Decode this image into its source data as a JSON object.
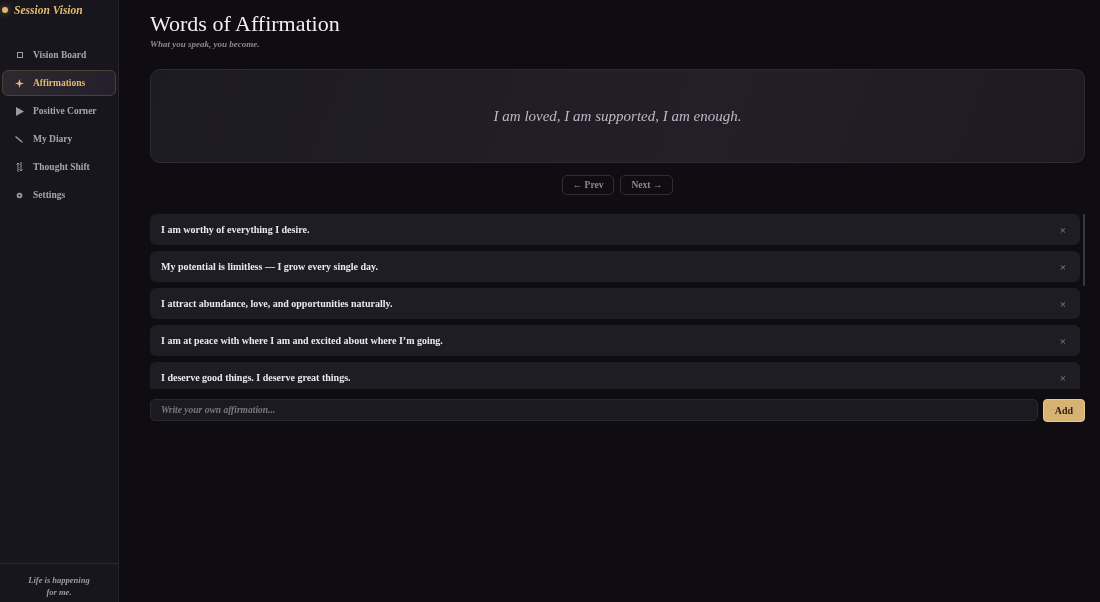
{
  "sidebar": {
    "brand": "Session Vision",
    "items": [
      {
        "label": "Vision Board",
        "selected": false
      },
      {
        "label": "Affirmations",
        "selected": true
      },
      {
        "label": "Positive Corner",
        "selected": false
      },
      {
        "label": "My Diary",
        "selected": false
      },
      {
        "label": "Thought Shift",
        "selected": false
      },
      {
        "label": "Settings",
        "selected": false
      }
    ],
    "footer": "Life is happening for me."
  },
  "header": {
    "title": "Words of Affirmation",
    "subtitle": "What you speak, you become."
  },
  "featured": {
    "text": "I am loved, I am supported, I am enough."
  },
  "pager": {
    "prev": "← Prev",
    "next": "Next →"
  },
  "affirmations": [
    {
      "text": "I am worthy of everything I desire.",
      "remove": "×"
    },
    {
      "text": "My potential is limitless — I grow every single day.",
      "remove": "×"
    },
    {
      "text": "I attract abundance, love, and opportunities naturally.",
      "remove": "×"
    },
    {
      "text": "I am at peace with where I am and excited about where I’m going.",
      "remove": "×"
    },
    {
      "text": "I deserve good things. I deserve great things.",
      "remove": "×"
    }
  ],
  "composer": {
    "placeholder": "Write your own affirmation...",
    "button": "Add"
  }
}
